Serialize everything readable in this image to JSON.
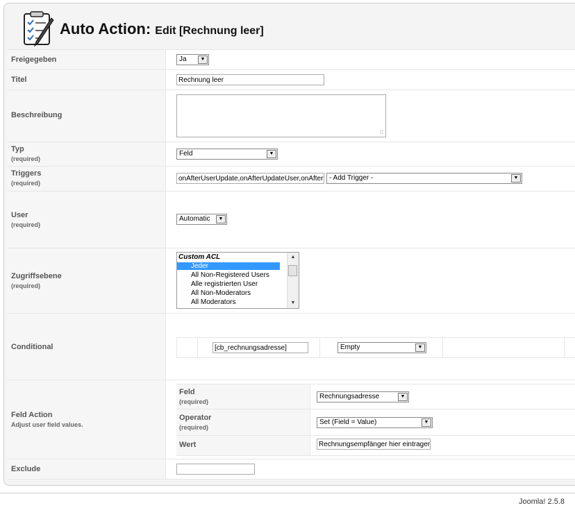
{
  "header": {
    "title_main": "Auto Action:",
    "title_sub": "Edit [Rechnung leer]",
    "logo_icon": "checklist-pen-icon"
  },
  "form": {
    "freigegeben": {
      "label": "Freigegeben",
      "value": "Ja"
    },
    "titel": {
      "label": "Titel",
      "value": "Rechnung leer"
    },
    "beschreibung": {
      "label": "Beschreibung",
      "value": ""
    },
    "typ": {
      "label": "Typ",
      "required": "(required)",
      "value": "Feld"
    },
    "triggers": {
      "label": "Triggers",
      "required": "(required)",
      "value": "onAfterUserUpdate,onAfterUpdateUser,onAfterUserActivate",
      "add_placeholder": "- Add Trigger -"
    },
    "user": {
      "label": "User",
      "required": "(required)",
      "value": "Automatic"
    },
    "zugriffsebene": {
      "label": "Zugriffsebene",
      "required": "(required)",
      "group": "Custom ACL",
      "options": [
        "Jeder",
        "All Non-Registered Users",
        "Alle registrierten User",
        "All Non-Moderators",
        "All Moderators"
      ],
      "selected": "Jeder"
    },
    "conditional": {
      "label": "Conditional",
      "field": "[cb_rechnungsadresse]",
      "operator": "Empty"
    },
    "feld_action": {
      "label": "Feld Action",
      "hint": "Adjust user field values.",
      "feld": {
        "label": "Feld",
        "required": "(required)",
        "value": "Rechnungsadresse"
      },
      "operator": {
        "label": "Operator",
        "required": "(required)",
        "value": "Set (Field = Value)"
      },
      "wert": {
        "label": "Wert",
        "value": "Rechnungsempfänger hier eintragen"
      }
    },
    "exclude": {
      "label": "Exclude",
      "value": ""
    }
  },
  "footer": {
    "version": "Joomla! 2.5.8"
  }
}
